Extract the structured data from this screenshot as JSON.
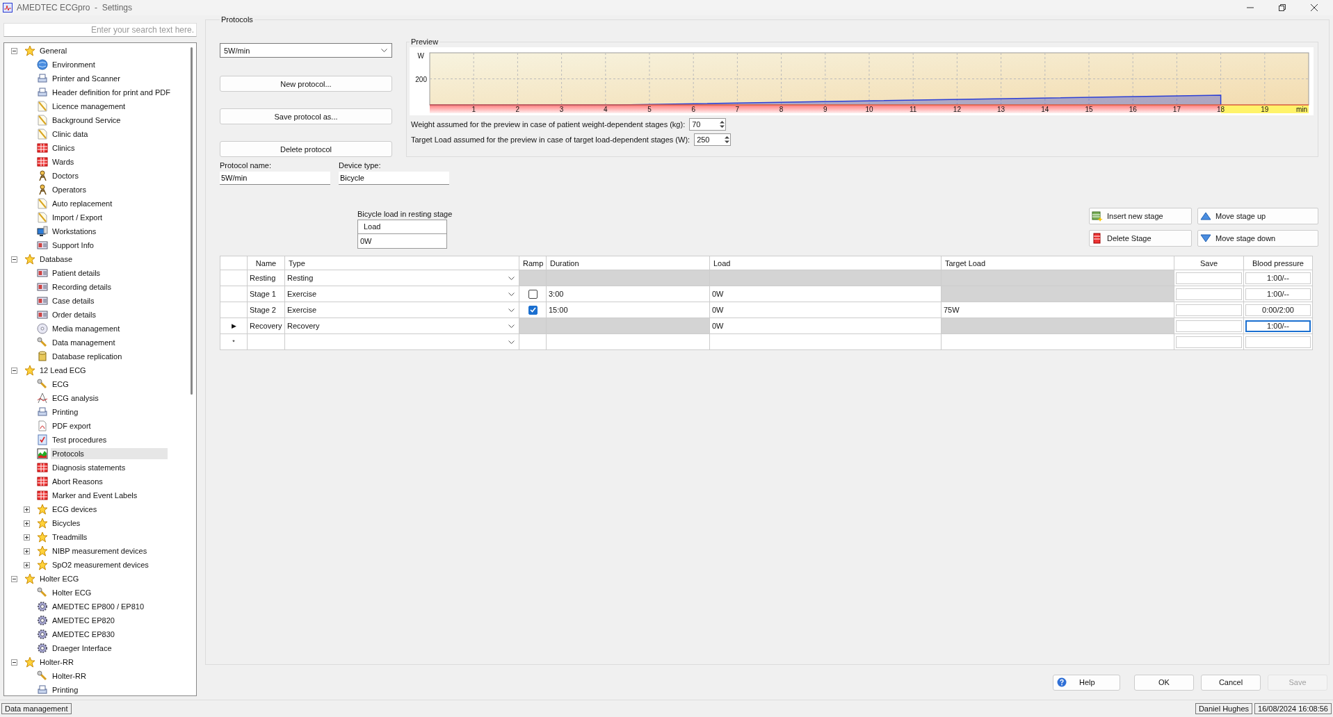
{
  "window": {
    "title": "AMEDTEC ECGpro  -  Settings"
  },
  "sidebar": {
    "search": {
      "placeholder": "Enter your search text here."
    },
    "tree": [
      {
        "label": "General",
        "kind": "star",
        "selected": false,
        "expanded": true,
        "children": [
          {
            "label": "Environment",
            "kind": "globe",
            "selected": false
          },
          {
            "label": "Printer and Scanner",
            "kind": "printer",
            "selected": false
          },
          {
            "label": "Header definition for print and PDF",
            "kind": "printer",
            "selected": false
          },
          {
            "label": "Licence management",
            "kind": "pencil",
            "selected": false
          },
          {
            "label": "Background Service",
            "kind": "pencil",
            "selected": false
          },
          {
            "label": "Clinic data",
            "kind": "pencil",
            "selected": false
          },
          {
            "label": "Clinics",
            "kind": "grid",
            "selected": false
          },
          {
            "label": "Wards",
            "kind": "grid",
            "selected": false
          },
          {
            "label": "Doctors",
            "kind": "person",
            "selected": false
          },
          {
            "label": "Operators",
            "kind": "person",
            "selected": false
          },
          {
            "label": "Auto replacement",
            "kind": "pencil",
            "selected": false
          },
          {
            "label": "Import / Export",
            "kind": "pencil",
            "selected": false
          },
          {
            "label": "Workstations",
            "kind": "monitor",
            "selected": false
          },
          {
            "label": "Support Info",
            "kind": "card",
            "selected": false
          }
        ]
      },
      {
        "label": "Database",
        "kind": "star",
        "selected": false,
        "expanded": true,
        "children": [
          {
            "label": "Patient details",
            "kind": "card",
            "selected": false
          },
          {
            "label": "Recording details",
            "kind": "card",
            "selected": false
          },
          {
            "label": "Case details",
            "kind": "card",
            "selected": false
          },
          {
            "label": "Order details",
            "kind": "card",
            "selected": false
          },
          {
            "label": "Media management",
            "kind": "disc",
            "selected": false
          },
          {
            "label": "Data management",
            "kind": "wrench",
            "selected": false
          },
          {
            "label": "Database replication",
            "kind": "cylinder",
            "selected": false
          }
        ]
      },
      {
        "label": "12 Lead ECG",
        "kind": "star",
        "selected": false,
        "expanded": true,
        "children": [
          {
            "label": "ECG",
            "kind": "wrench",
            "selected": false
          },
          {
            "label": "ECG analysis",
            "kind": "compass",
            "selected": false
          },
          {
            "label": "Printing",
            "kind": "printer",
            "selected": false
          },
          {
            "label": "PDF export",
            "kind": "pdf",
            "selected": false
          },
          {
            "label": "Test procedures",
            "kind": "checklist",
            "selected": false
          },
          {
            "label": "Protocols",
            "kind": "chart",
            "selected": true
          },
          {
            "label": "Diagnosis statements",
            "kind": "grid",
            "selected": false
          },
          {
            "label": "Abort Reasons",
            "kind": "grid",
            "selected": false
          },
          {
            "label": "Marker and Event Labels",
            "kind": "grid",
            "selected": false
          },
          {
            "label": "ECG devices",
            "kind": "star",
            "selected": false,
            "expanded": false
          },
          {
            "label": "Bicycles",
            "kind": "star",
            "selected": false,
            "expanded": false
          },
          {
            "label": "Treadmills",
            "kind": "star",
            "selected": false,
            "expanded": false
          },
          {
            "label": "NIBP measurement devices",
            "kind": "star",
            "selected": false,
            "expanded": false
          },
          {
            "label": "SpO2 measurement devices",
            "kind": "star",
            "selected": false,
            "expanded": false
          }
        ]
      },
      {
        "label": "Holter ECG",
        "kind": "star",
        "selected": false,
        "expanded": true,
        "children": [
          {
            "label": "Holter ECG",
            "kind": "wrench",
            "selected": false
          },
          {
            "label": "AMEDTEC EP800 / EP810",
            "kind": "gear",
            "selected": false
          },
          {
            "label": "AMEDTEC EP820",
            "kind": "gear",
            "selected": false
          },
          {
            "label": "AMEDTEC EP830",
            "kind": "gear",
            "selected": false
          },
          {
            "label": "Draeger Interface",
            "kind": "gear",
            "selected": false
          }
        ]
      },
      {
        "label": "Holter-RR",
        "kind": "star",
        "selected": false,
        "expanded": true,
        "children": [
          {
            "label": "Holter-RR",
            "kind": "wrench",
            "selected": false
          },
          {
            "label": "Printing",
            "kind": "printer",
            "selected": false
          }
        ]
      }
    ]
  },
  "group_title": "Protocols",
  "protocol_select": {
    "value": "5W/min"
  },
  "protocol_buttons": [
    "New protocol...",
    "Save protocol as...",
    "Delete protocol"
  ],
  "preview": {
    "title": "Preview",
    "chart_data": {
      "type": "area",
      "xlabel": "min",
      "ylabel": "W",
      "x": [
        0,
        4.3,
        18,
        18
      ],
      "grid": true,
      "series": [
        {
          "color": "#2b3fd6",
          "values": [
            0,
            0,
            75,
            0
          ]
        }
      ],
      "xlim": [
        0,
        20
      ],
      "ylim": [
        0,
        400
      ],
      "xticks": [
        1,
        2,
        3,
        4,
        5,
        6,
        7,
        8,
        9,
        10,
        11,
        12,
        13,
        14,
        15,
        16,
        17,
        18,
        19
      ],
      "yticks": [
        200
      ]
    },
    "settings": [
      {
        "label": "Weight assumed for the preview in case of patient weight-dependent stages (kg):",
        "value": "70"
      },
      {
        "label": "Target Load assumed for the preview in case of target load-dependent stages (W):",
        "value": "250"
      }
    ]
  },
  "protocol_name": {
    "label": "Protocol name:",
    "value": "5W/min"
  },
  "device_type": {
    "label": "Device type:",
    "value": "Bicycle"
  },
  "resting_load": {
    "label": "Bicycle load in resting stage",
    "column": "Load",
    "value": "0W"
  },
  "stage_buttons": [
    {
      "label": "Insert new stage",
      "kind": "insert"
    },
    {
      "label": "Move stage up",
      "kind": "up"
    },
    {
      "label": "Delete Stage",
      "kind": "delete"
    },
    {
      "label": "Move stage down",
      "kind": "down"
    }
  ],
  "table": {
    "columns": [
      "Name",
      "Type",
      "Ramp",
      "Duration",
      "Load",
      "Target Load",
      "Save",
      "Blood pressure"
    ],
    "rows": [
      {
        "name": "Resting",
        "type": "Resting",
        "locked": {
          "ramp": true,
          "duration": true,
          "load": true,
          "target_load": true
        },
        "blood_pressure": {
          "value": "1:00/--",
          "focused": false
        }
      },
      {
        "name": "Stage 1",
        "type": "Exercise",
        "ramp": false,
        "duration": "3:00",
        "load": "0W",
        "locked": {
          "ramp": false,
          "duration": false,
          "load": false,
          "target_load": true
        },
        "blood_pressure": {
          "value": "1:00/--",
          "focused": false
        }
      },
      {
        "name": "Stage 2",
        "type": "Exercise",
        "ramp": true,
        "duration": "15:00",
        "load": "0W",
        "target_load": "75W",
        "locked": {
          "ramp": false,
          "duration": false,
          "load": false,
          "target_load": false
        },
        "blood_pressure": {
          "value": "0:00/2:00",
          "focused": false
        }
      },
      {
        "marker": "▶",
        "name": "Recovery",
        "type": "Recovery",
        "load": "0W",
        "locked": {
          "ramp": true,
          "duration": true,
          "load": false,
          "target_load": true
        },
        "blood_pressure": {
          "value": "1:00/--",
          "focused": true
        }
      },
      {
        "marker": "*",
        "locked": {
          "ramp": false,
          "duration": false,
          "load": false,
          "target_load": false
        },
        "blood_pressure": {
          "focused": false
        }
      }
    ]
  },
  "footer_buttons": [
    {
      "label": "Help",
      "kind": "help",
      "disabled": false
    },
    {
      "label": "OK",
      "kind": "plain",
      "disabled": false
    },
    {
      "label": "Cancel",
      "kind": "plain",
      "disabled": false
    },
    {
      "label": "Save",
      "kind": "plain",
      "disabled": true
    }
  ],
  "status_bar": {
    "left": "Data management",
    "user": "Daniel Hughes",
    "time": "16/08/2024 16:08:56"
  }
}
